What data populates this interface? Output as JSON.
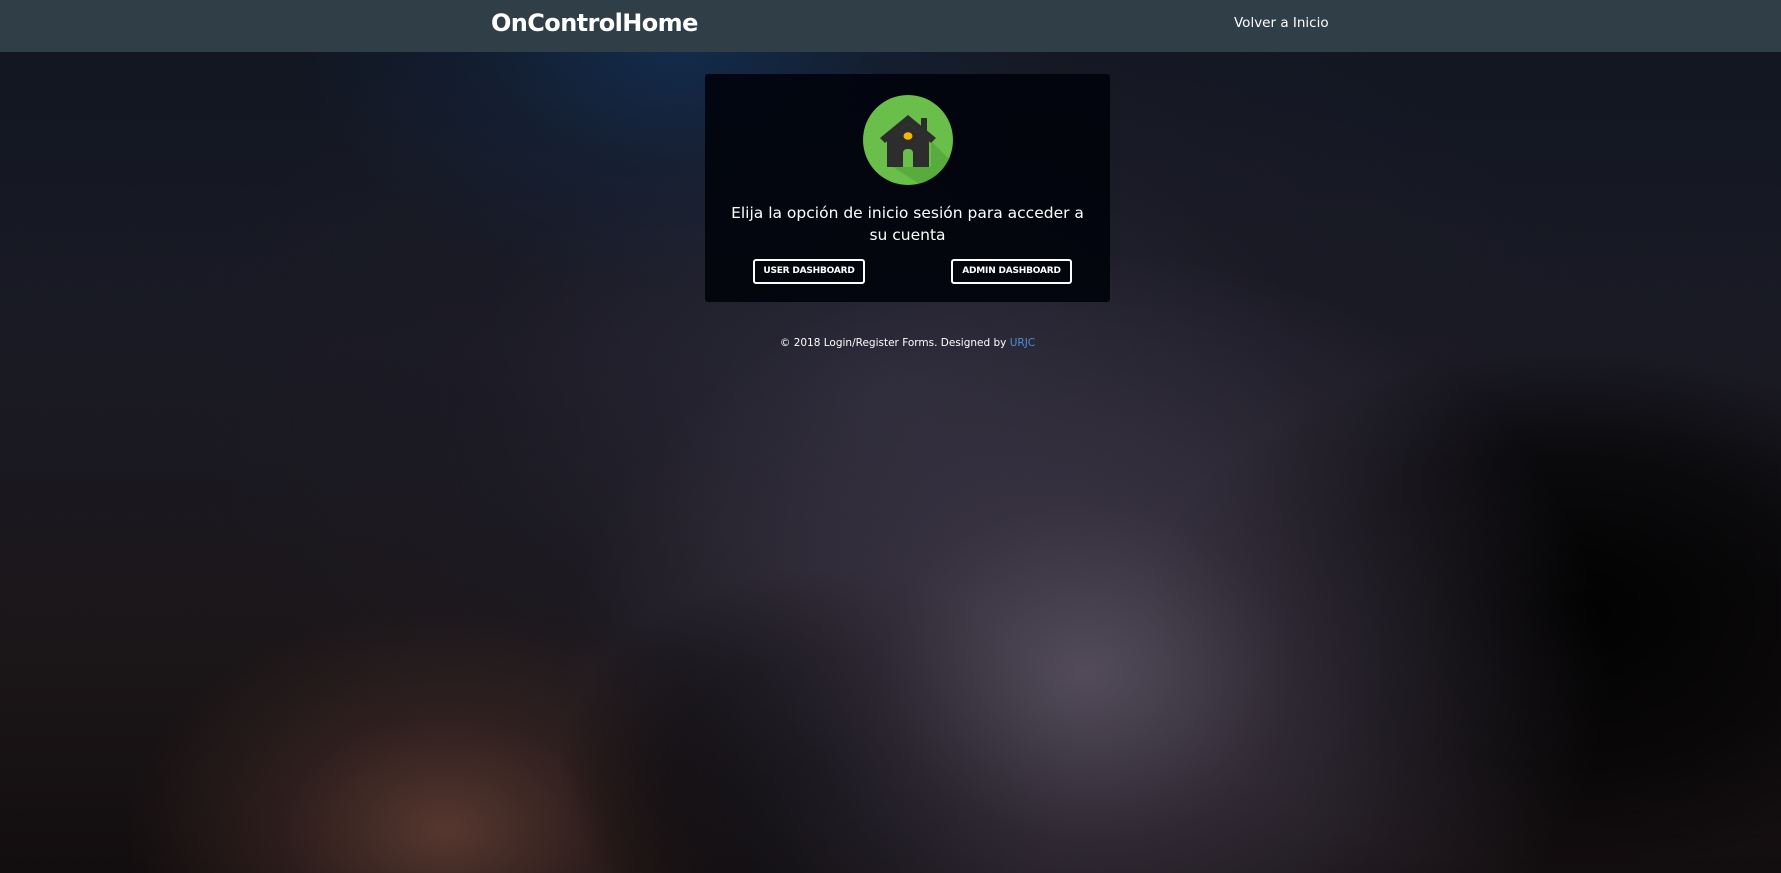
{
  "header": {
    "brand": "OnControlHome",
    "back_link": "Volver a Inicio",
    "background_color": "#2f3e47"
  },
  "card": {
    "logo_icon": "house-icon",
    "logo_colors": {
      "circle": "#6abf4b",
      "house": "#2d2d2d",
      "light": "#f5b800"
    },
    "prompt": "Elija la opción de inicio sesión para acceder a su cuenta",
    "user_button": "USER DASHBOARD",
    "admin_button": "ADMIN DASHBOARD"
  },
  "footer": {
    "text": "© 2018 Login/Register Forms. Designed by ",
    "link_text": "URJC",
    "link_color": "#4a8fd8"
  }
}
